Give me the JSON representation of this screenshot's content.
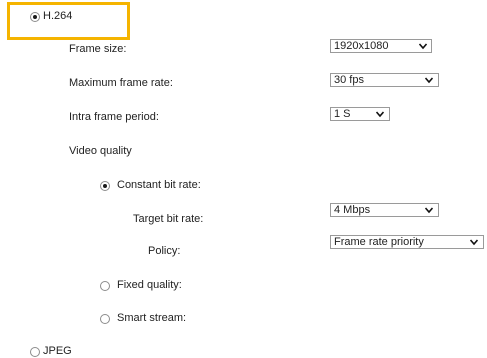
{
  "codec_options": {
    "h264_label": "H.264",
    "jpeg_label": "JPEG",
    "selected": "H.264"
  },
  "h264_settings": {
    "frame_size": {
      "label": "Frame size:",
      "value": "1920x1080"
    },
    "max_frame_rate": {
      "label": "Maximum frame rate:",
      "value": "30 fps"
    },
    "intra_frame_period": {
      "label": "Intra frame period:",
      "value": "1 S"
    },
    "video_quality": {
      "label": "Video quality",
      "mode_selected": "Constant bit rate:",
      "constant_bit_rate": {
        "label": "Constant bit rate:",
        "target_bit_rate": {
          "label": "Target bit rate:",
          "value": "4 Mbps"
        },
        "policy": {
          "label": "Policy:",
          "value": "Frame rate priority"
        }
      },
      "fixed_quality_label": "Fixed quality:",
      "smart_stream_label": "Smart stream:"
    }
  },
  "highlight": {
    "color": "#f5b400",
    "target": "H.264"
  }
}
